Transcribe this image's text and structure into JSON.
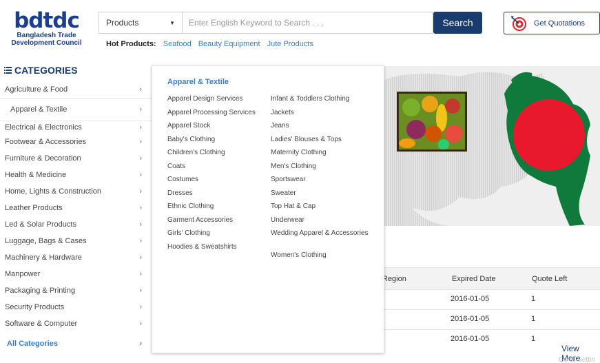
{
  "logo": {
    "mark": "bdtdc",
    "name_line1": "Bangladesh Trade",
    "name_line2": "Development Council"
  },
  "search": {
    "category_value": "Products",
    "placeholder": "Enter English Keyword to Search . . .",
    "button_label": "Search"
  },
  "quotation": {
    "label": "Get Quotations"
  },
  "hot_products": {
    "label": "Hot Products:",
    "links": [
      "Seafood",
      "Beauty Equipment",
      "Jute Products"
    ]
  },
  "categories": {
    "heading": "CATEGORIES",
    "items": [
      "Agriculture & Food",
      "Apparel & Textile",
      "Electrical & Electronics",
      "Footwear & Accessories",
      "Furniture & Decoration",
      "Health & Medicine",
      "Home, Lights & Construction",
      "Leather Products",
      "Led & Solar Products",
      "Luggage, Bags & Cases",
      "Machinery & Hardware",
      "Manpower",
      "Packaging & Printing",
      "Security Products",
      "Software & Computer"
    ],
    "all_label": "All Categories"
  },
  "flyout": {
    "heading": "Apparel & Textile",
    "col1": [
      "Apparel Design Services",
      "Apparel Processing Services",
      "Apparel Stock",
      "Baby's Clothing",
      "Children's Clothing",
      "Coats",
      "Costumes",
      "Dresses",
      "Ethnic Clothing",
      "Garment Accessories",
      "Girls' Clothing",
      "Hoodies & Sweatshirts"
    ],
    "col2": [
      "Infant & Toddlers Clothing",
      "Jackets",
      "Jeans",
      "Ladies' Blouses & Tops",
      "Maternity Clothing",
      "Men's Clothing",
      "Sportswear",
      "Sweater",
      "Top Hat & Cap",
      "Underwear",
      "Wedding Apparel & Accessories",
      "Women's Clothing"
    ]
  },
  "table": {
    "headers": [
      "Region",
      "Expired Date",
      "Quote Left"
    ],
    "rows": [
      {
        "date": "2016-01-05",
        "left": "1"
      },
      {
        "date": "2016-01-05",
        "left": "1"
      },
      {
        "date": "2016-01-05",
        "left": "1"
      }
    ],
    "view_more": "View More"
  },
  "watermark": "Go to Settin",
  "colors": {
    "brand_blue": "#1a3b6e",
    "link_blue": "#3a7ebf",
    "flag_green": "#0f7a3c",
    "flag_red": "#e8192c"
  }
}
